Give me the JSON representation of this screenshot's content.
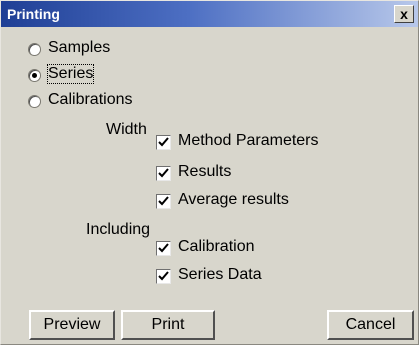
{
  "window": {
    "title": "Printing",
    "close_glyph": "x"
  },
  "mode_group": {
    "options": [
      {
        "label": "Samples",
        "selected": false
      },
      {
        "label": "Series",
        "selected": true
      },
      {
        "label": "Calibrations",
        "selected": false
      }
    ]
  },
  "width_group": {
    "heading": "Width",
    "items": [
      {
        "label": "Method Parameters",
        "checked": true
      },
      {
        "label": "Results",
        "checked": true
      },
      {
        "label": "Average results",
        "checked": true
      }
    ]
  },
  "including_group": {
    "heading": "Including",
    "items": [
      {
        "label": "Calibration",
        "checked": true
      },
      {
        "label": "Series Data",
        "checked": true
      }
    ]
  },
  "buttons": {
    "preview_label": "Preview",
    "print_label": "Print",
    "cancel_label": "Cancel"
  },
  "colors": {
    "title_gradient_start": "#1f3f95",
    "title_gradient_end": "#b8c8ea",
    "dialog_face": "#d8d6cc"
  }
}
